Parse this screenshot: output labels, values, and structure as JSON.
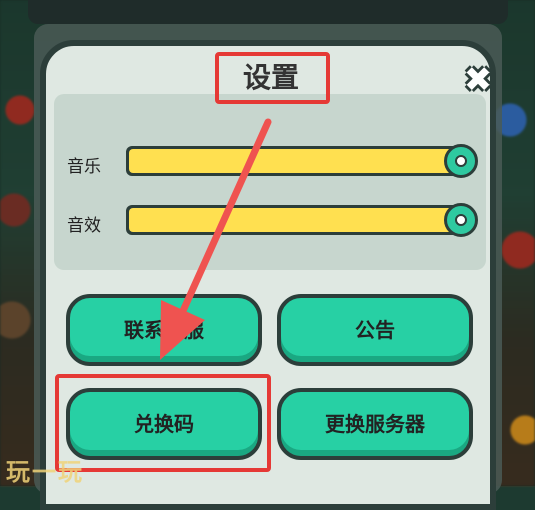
{
  "dialog": {
    "title": "设置",
    "close_symbol": "✖"
  },
  "settings": [
    {
      "label": "音乐",
      "level": 1.0
    },
    {
      "label": "音效",
      "level": 1.0
    }
  ],
  "buttons": {
    "contact": "联系客服",
    "notice": "公告",
    "redeem": "兑换码",
    "switch_server": "更换服务器"
  },
  "watermark": "玩一玩",
  "colors": {
    "accent_button": "#27d0a4",
    "slider_fill": "#ffe050",
    "highlight": "#e53935"
  }
}
